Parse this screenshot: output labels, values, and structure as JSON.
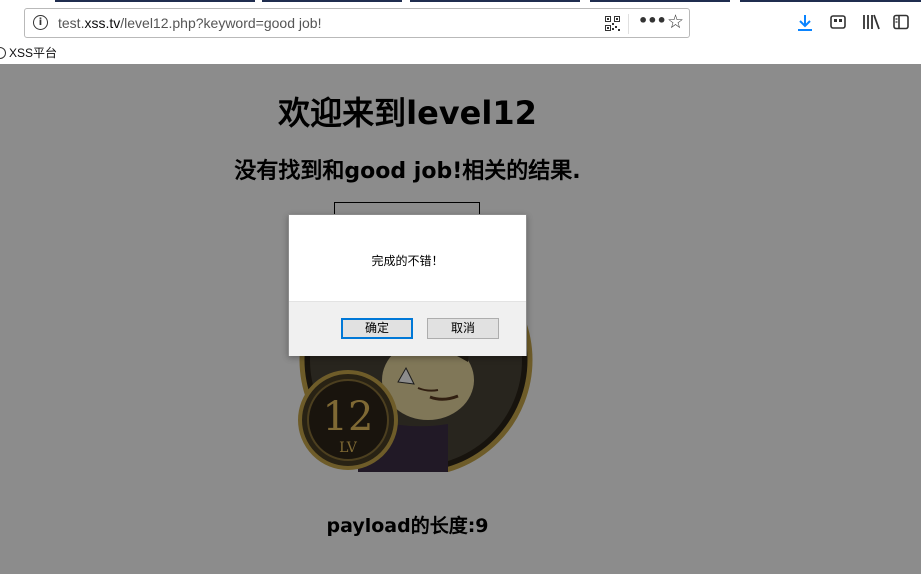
{
  "browser": {
    "url_prefix": "test.",
    "url_domain": "xss.tv",
    "url_path": "/level12.php?keyword=good job!",
    "bookmark": "XSS平台"
  },
  "page": {
    "heading": "欢迎来到level12",
    "result_text": "没有找到和good job!相关的结果.",
    "badge_level": "12",
    "badge_lv": "LV",
    "payload_text": "payload的长度:9"
  },
  "dialog": {
    "message": "完成的不错！",
    "ok_label": "确定",
    "cancel_label": "取消"
  },
  "colors": {
    "overlay": "#000000",
    "accent": "#0078d7",
    "download": "#0a84ff"
  }
}
